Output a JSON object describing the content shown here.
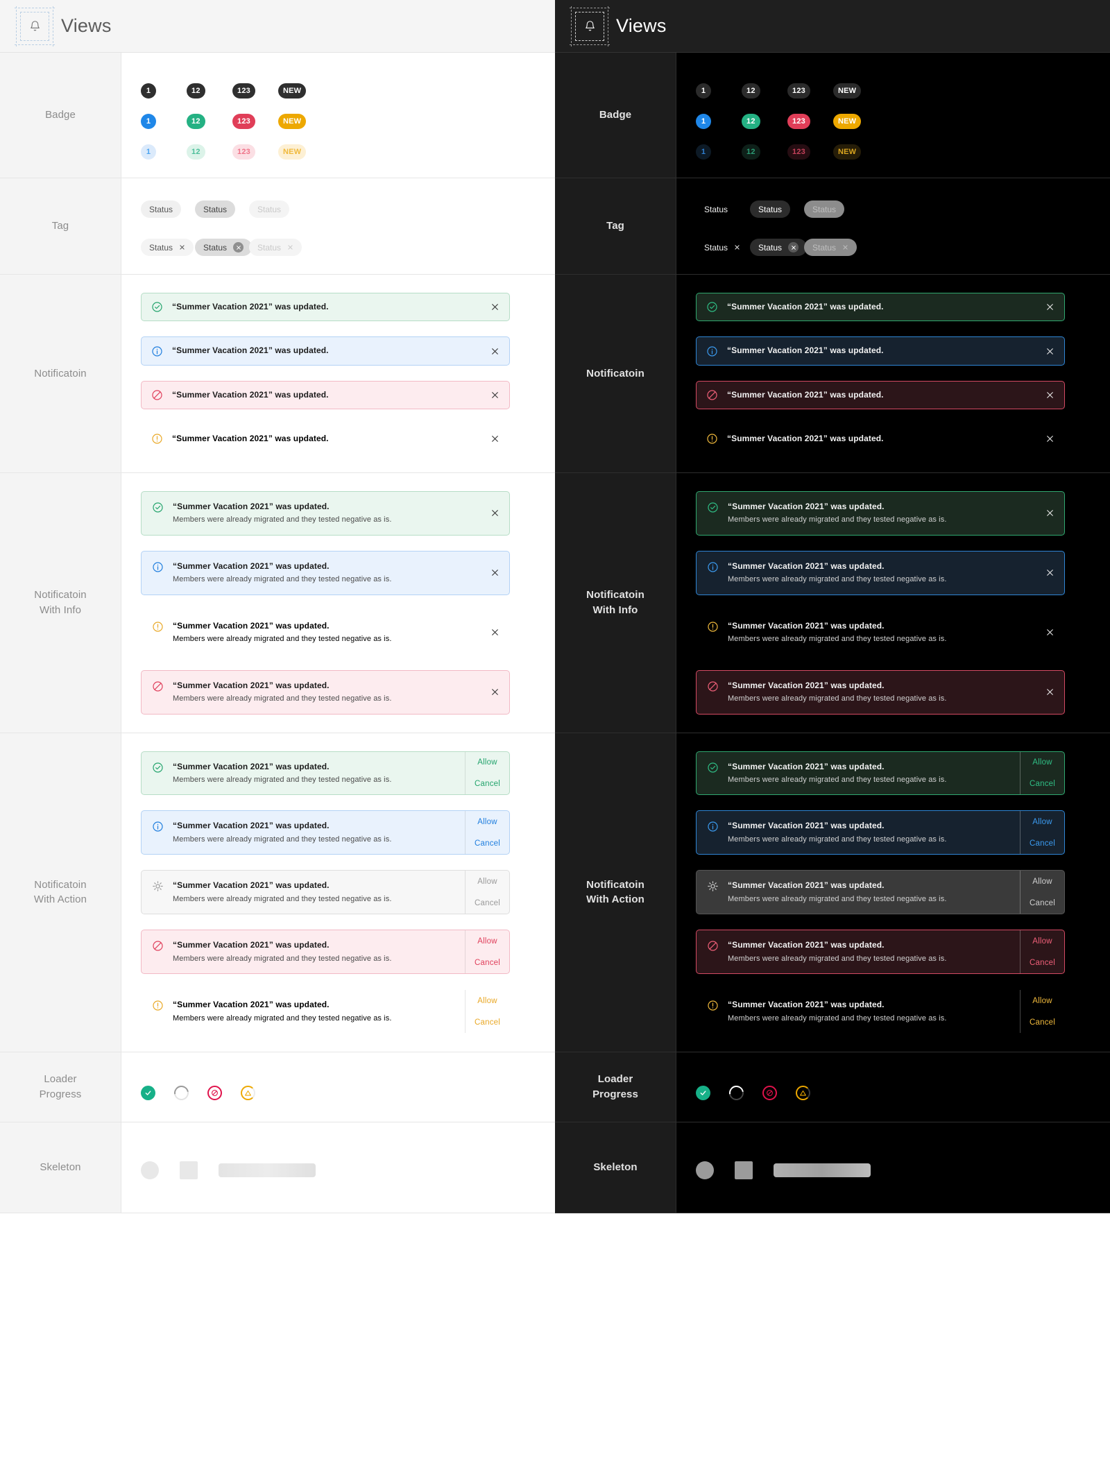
{
  "header": {
    "title": "Views",
    "icon": "bell-icon"
  },
  "rows": [
    {
      "key": "badge",
      "label": "Badge"
    },
    {
      "key": "tag",
      "label": "Tag"
    },
    {
      "key": "notification",
      "label": "Notificatoin"
    },
    {
      "key": "notif_info",
      "label": "Notificatoin\nWith Info"
    },
    {
      "key": "notif_action",
      "label": "Notificatoin\nWith Action"
    },
    {
      "key": "loader",
      "label": "Loader\nProgress"
    },
    {
      "key": "skeleton",
      "label": "Skeleton"
    }
  ],
  "badge": {
    "labels": [
      "1",
      "12",
      "123",
      "NEW"
    ],
    "rows": [
      {
        "variant": "solid-dark",
        "colors_light": [
          "#2f2f2f",
          "#2f2f2f",
          "#2f2f2f",
          "#2f2f2f"
        ],
        "text_light": "#ffffff",
        "colors_dark": [
          "#2b2b2b",
          "#2b2b2b",
          "#2b2b2b",
          "#2b2b2b"
        ],
        "text_dark": "#ffffff"
      },
      {
        "variant": "solid-color",
        "colors_light": [
          "#1f87e8",
          "#24b183",
          "#e03e58",
          "#eda800"
        ],
        "text_light": "#ffffff",
        "colors_dark": [
          "#1f87e8",
          "#24b183",
          "#e03e58",
          "#eda800"
        ],
        "text_dark": "#ffffff"
      },
      {
        "variant": "soft",
        "colors_light": [
          "#dbeafb",
          "#dcf3e9",
          "#fbdfe4",
          "#fdf0d4"
        ],
        "text_colors_light": [
          "#4ba3ef",
          "#4dbf9b",
          "#ef7489",
          "#f0b93c"
        ],
        "colors_dark": [
          "#0d1a26",
          "#0e2019",
          "#260d12",
          "#261d08"
        ],
        "text_colors_dark": [
          "#2f7fd0",
          "#2c9b74",
          "#c4415a",
          "#d9a41f"
        ]
      }
    ]
  },
  "tag": {
    "label": "Status",
    "close_icon": "close-icon",
    "rows": [
      {
        "has_close": false,
        "light": [
          {
            "bg": "#f0f0f0",
            "fg": "#555555"
          },
          {
            "bg": "#dcdcdc",
            "fg": "#444444"
          },
          {
            "bg": "#f4f4f4",
            "fg": "#c9c9c9"
          }
        ],
        "dark": [
          {
            "bg": "transparent",
            "fg": "#f0f0f0"
          },
          {
            "bg": "#2c2c2c",
            "fg": "#ffffff"
          },
          {
            "bg": "#8c8c8c",
            "fg": "#bfbfbf"
          }
        ]
      },
      {
        "has_close": true,
        "light": [
          {
            "bg": "#f4f4f4",
            "fg": "#555555",
            "chip": "transparent",
            "chipfg": "#555555"
          },
          {
            "bg": "#dcdcdc",
            "fg": "#444444",
            "chip": "#8f8f8f",
            "chipfg": "#ffffff"
          },
          {
            "bg": "#f4f4f4",
            "fg": "#c9c9c9",
            "chip": "transparent",
            "chipfg": "#c9c9c9"
          }
        ],
        "dark": [
          {
            "bg": "transparent",
            "fg": "#f0f0f0",
            "chip": "transparent",
            "chipfg": "#f0f0f0"
          },
          {
            "bg": "#2c2c2c",
            "fg": "#ffffff",
            "chip": "#5a5a5a",
            "chipfg": "#ffffff"
          },
          {
            "bg": "#8c8c8c",
            "fg": "#bfbfbf",
            "chip": "transparent",
            "chipfg": "#bfbfbf"
          }
        ]
      }
    ]
  },
  "notification": {
    "title": "“Summer Vacation 2021” was updated.",
    "description": "Members were already migrated and they tested negative as is.",
    "close_icon": "close-icon",
    "actions": {
      "allow": "Allow",
      "cancel": "Cancel"
    },
    "simple_order": [
      "success",
      "info",
      "error",
      "warning"
    ],
    "info_order": [
      "success",
      "info",
      "warning",
      "error"
    ],
    "action_order": [
      "success",
      "info",
      "neutral",
      "error",
      "warning"
    ],
    "types": {
      "success": {
        "icon": "check-circle-icon",
        "accent_light": "#24a46d",
        "accent_dark": "#2fbe85"
      },
      "info": {
        "icon": "info-circle-icon",
        "accent_light": "#1f7ede",
        "accent_dark": "#3b9bf0"
      },
      "error": {
        "icon": "ban-circle-icon",
        "accent_light": "#e0405c",
        "accent_dark": "#ef5f78"
      },
      "warning": {
        "icon": "alert-circle-icon",
        "accent_light": "#e9a826",
        "accent_dark": "#f0b93c"
      },
      "neutral": {
        "icon": "spinner-sun-icon",
        "accent_light": "#9a9a9a",
        "accent_dark": "#d0d0d0"
      }
    }
  },
  "loader": {
    "items": [
      {
        "name": "loader-complete-icon",
        "state": "complete",
        "color_light": "#17b088",
        "color_dark": "#17b088"
      },
      {
        "name": "loader-spinner-icon",
        "state": "loading",
        "color_light": "#9a9a9a",
        "color_dark": "#ffffff"
      },
      {
        "name": "loader-error-icon",
        "state": "error",
        "color_light": "#e0124b",
        "color_dark": "#e0124b"
      },
      {
        "name": "loader-warning-icon",
        "state": "warning",
        "color_light": "#eda800",
        "color_dark": "#eda800"
      }
    ]
  },
  "skeleton": {
    "items": [
      {
        "name": "skeleton-avatar",
        "shape": "circle"
      },
      {
        "name": "skeleton-thumb",
        "shape": "square"
      },
      {
        "name": "skeleton-line",
        "shape": "bar"
      }
    ]
  },
  "themes": [
    {
      "key": "light",
      "name": "light-theme"
    },
    {
      "key": "dark",
      "name": "dark-theme"
    }
  ]
}
